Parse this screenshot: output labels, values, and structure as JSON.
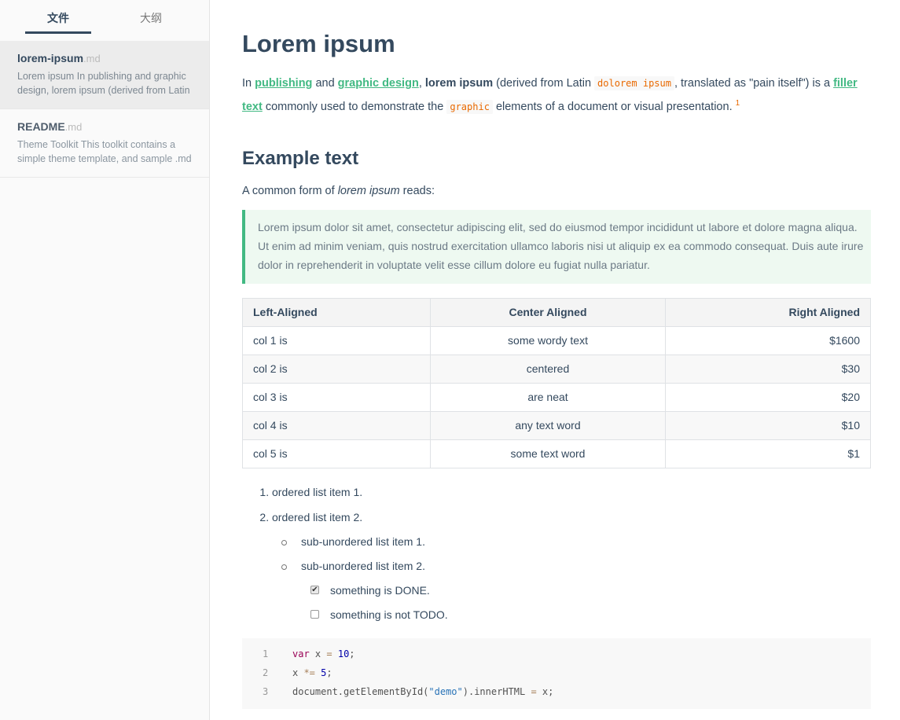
{
  "sidebar": {
    "tabs": [
      {
        "label": "文件"
      },
      {
        "label": "大纲"
      }
    ],
    "files": [
      {
        "name": "lorem-ipsum",
        "ext": ".md",
        "preview": "Lorem ipsum In publishing and graphic design, lorem ipsum (derived from Latin"
      },
      {
        "name": "README",
        "ext": ".md",
        "preview": "Theme Toolkit This toolkit contains a simple theme template, and sample .md"
      }
    ]
  },
  "doc": {
    "title": "Lorem ipsum",
    "intro": {
      "t1": "In ",
      "link1": "publishing",
      "t2": " and ",
      "link2": "graphic design",
      "t3": ", ",
      "bold1": "lorem ipsum",
      "t4": " (derived from Latin ",
      "code1": "dolorem ipsum",
      "t5": ", translated as \"pain itself\") is a ",
      "link3": "filler text",
      "t6": " commonly used to demonstrate the ",
      "code2": "graphic",
      "t7": " elements of a document or visual presentation. ",
      "footnote": "1"
    },
    "h2": "Example text",
    "lead": {
      "t1": "A common form of ",
      "em": "lorem ipsum",
      "t2": " reads:"
    },
    "quote": "Lorem ipsum dolor sit amet, consectetur adipiscing elit, sed do eiusmod tempor incididunt ut labore et dolore magna aliqua. Ut enim ad minim veniam, quis nostrud exercitation ullamco laboris nisi ut aliquip ex ea commodo consequat. Duis aute irure dolor in reprehenderit in voluptate velit esse cillum dolore eu fugiat nulla pariatur.",
    "table": {
      "headers": [
        "Left-Aligned",
        "Center Aligned",
        "Right Aligned"
      ],
      "rows": [
        [
          "col 1 is",
          "some wordy text",
          "$1600"
        ],
        [
          "col 2 is",
          "centered",
          "$30"
        ],
        [
          "col 3 is",
          "are neat",
          "$20"
        ],
        [
          "col 4 is",
          "any text word",
          "$10"
        ],
        [
          "col 5 is",
          "some text word",
          "$1"
        ]
      ]
    },
    "list": {
      "ordered": [
        "ordered list item 1.",
        "ordered list item 2."
      ],
      "unordered": [
        "sub-unordered list item 1.",
        "sub-unordered list item 2."
      ],
      "tasks": [
        {
          "label": "something is DONE.",
          "checked": true
        },
        {
          "label": "something is not TODO.",
          "checked": false
        }
      ]
    },
    "code": {
      "line_numbers": [
        "1",
        "2",
        "3"
      ],
      "l1": {
        "kw": "var",
        "a": " x ",
        "op": "=",
        "b": " ",
        "num": "10",
        "c": ";"
      },
      "l2": {
        "a": "x ",
        "op": "*=",
        "b": " ",
        "num": "5",
        "c": ";"
      },
      "l3": {
        "a": "document.getElementById(",
        "str": "\"demo\"",
        "b": ").innerHTML ",
        "op": "=",
        "c": " x;"
      }
    }
  }
}
